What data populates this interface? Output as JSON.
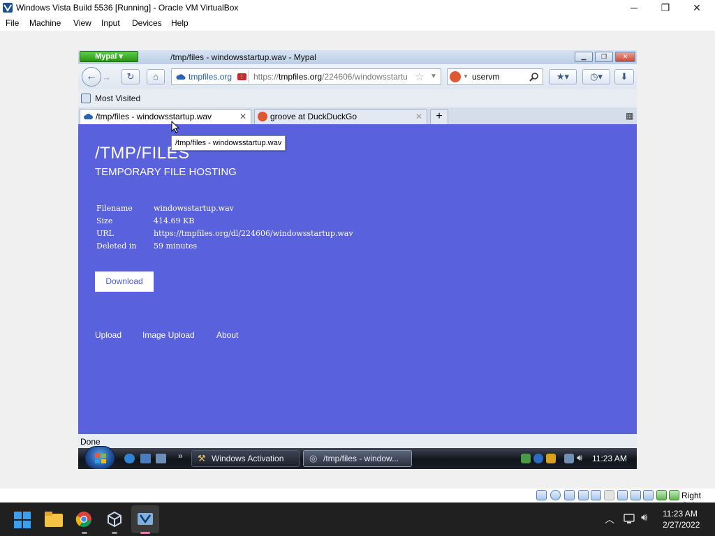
{
  "host_window": {
    "title": "Windows Vista Build 5536 [Running] - Oracle VM VirtualBox",
    "menu": [
      "File",
      "Machine",
      "View",
      "Input",
      "Devices",
      "Help"
    ],
    "controls": {
      "minimize": "─",
      "maximize": "❐",
      "close": "✕"
    }
  },
  "browser": {
    "app_button": "Mypal",
    "window_title": "/tmp/files - windowsstartup.wav - Mypal",
    "site_identity": "tmpfiles.org",
    "url_prefix": "https://",
    "url_domain": "tmpfiles.org",
    "url_path": "/224606/windowsstartu",
    "search_value": "uservm",
    "bookmarks": [
      "Most Visited"
    ],
    "tabs": [
      {
        "label": "/tmp/files - windowsstartup.wav",
        "active": true
      },
      {
        "label": "groove at DuckDuckGo",
        "active": false
      }
    ],
    "new_tab": "+",
    "tooltip": "/tmp/files - windowsstartup.wav",
    "status": "Done"
  },
  "page": {
    "title": "/TMP/FILES",
    "subtitle": "TEMPORARY FILE HOSTING",
    "file_info": [
      {
        "label": "Filename",
        "value": "windowsstartup.wav"
      },
      {
        "label": "Size",
        "value": "414.69 KB"
      },
      {
        "label": "URL",
        "value": "https://tmpfiles.org/dl/224606/windowsstartup.wav"
      },
      {
        "label": "Deleted in",
        "value": "59 minutes"
      }
    ],
    "download_label": "Download",
    "footer_links": [
      "Upload",
      "Image Upload",
      "About"
    ],
    "colors": {
      "background": "#5962dc",
      "button_text": "#4a59d6"
    }
  },
  "vista_taskbar": {
    "tasks": [
      "Windows Activation",
      "/tmp/files - window..."
    ],
    "clock": "11:23 AM"
  },
  "vbox_status": {
    "host_key": "Right Ctrl"
  },
  "host_taskbar": {
    "time": "11:23 AM",
    "date": "2/27/2022"
  }
}
